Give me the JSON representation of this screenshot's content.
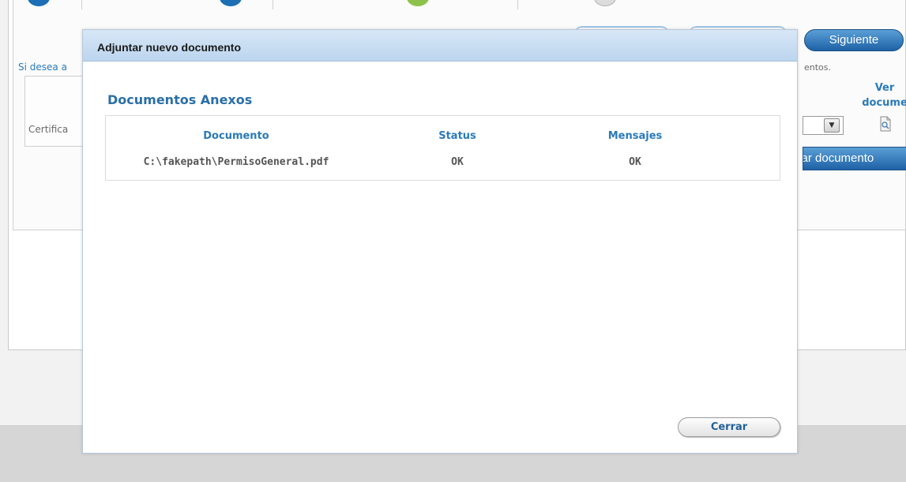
{
  "background": {
    "steps": [
      "step-completed",
      "step-completed",
      "step-current",
      "step-pending"
    ],
    "next_button_label": "Siguiente",
    "hint_left": "Si desea a",
    "hint_right": "entos.",
    "cert_label": "Certifica",
    "ver_label": "Ver docume",
    "select_arrow_icon": "chevron-down-icon",
    "view_icon": "document-magnifier-icon",
    "attach_button_label": "ntar documento"
  },
  "modal": {
    "title": "Adjuntar nuevo documento",
    "section_title": "Documentos Anexos",
    "table": {
      "headers": [
        "Documento",
        "Status",
        "Mensajes"
      ],
      "rows": [
        [
          "C:\\fakepath\\PermisoGeneral.pdf",
          "OK",
          "OK"
        ]
      ]
    },
    "close_button_label": "Cerrar"
  },
  "colors": {
    "accent": "#2a7ab8",
    "button_blue": "#1e62a6",
    "step_green": "#8cc24a"
  }
}
